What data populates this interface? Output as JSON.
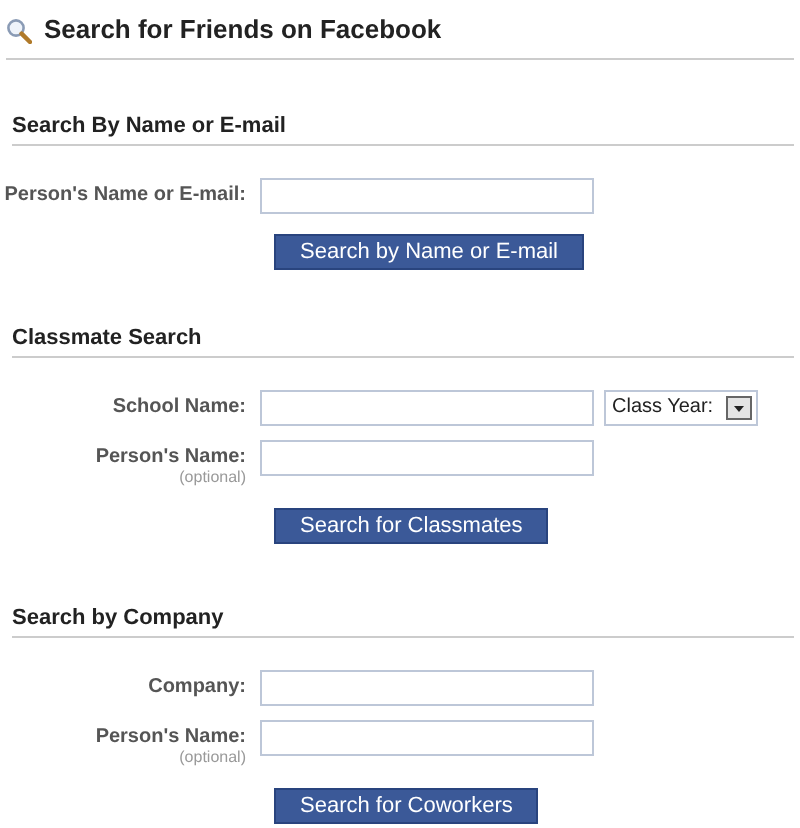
{
  "title": "Search for Friends on Facebook",
  "sections": [
    {
      "heading": "Search By Name or E-mail",
      "fields": [
        {
          "label": "Person's Name or E-mail:"
        }
      ],
      "button": "Search by Name or E-mail"
    },
    {
      "heading": "Classmate Search",
      "fields": [
        {
          "label": "School Name:",
          "extra": "Class Year:"
        },
        {
          "label": "Person's Name:",
          "note": "(optional)"
        }
      ],
      "button": "Search for Classmates"
    },
    {
      "heading": "Search by Company",
      "fields": [
        {
          "label": "Company:"
        },
        {
          "label": "Person's Name:",
          "note": "(optional)"
        }
      ],
      "button": "Search for Coworkers"
    }
  ]
}
